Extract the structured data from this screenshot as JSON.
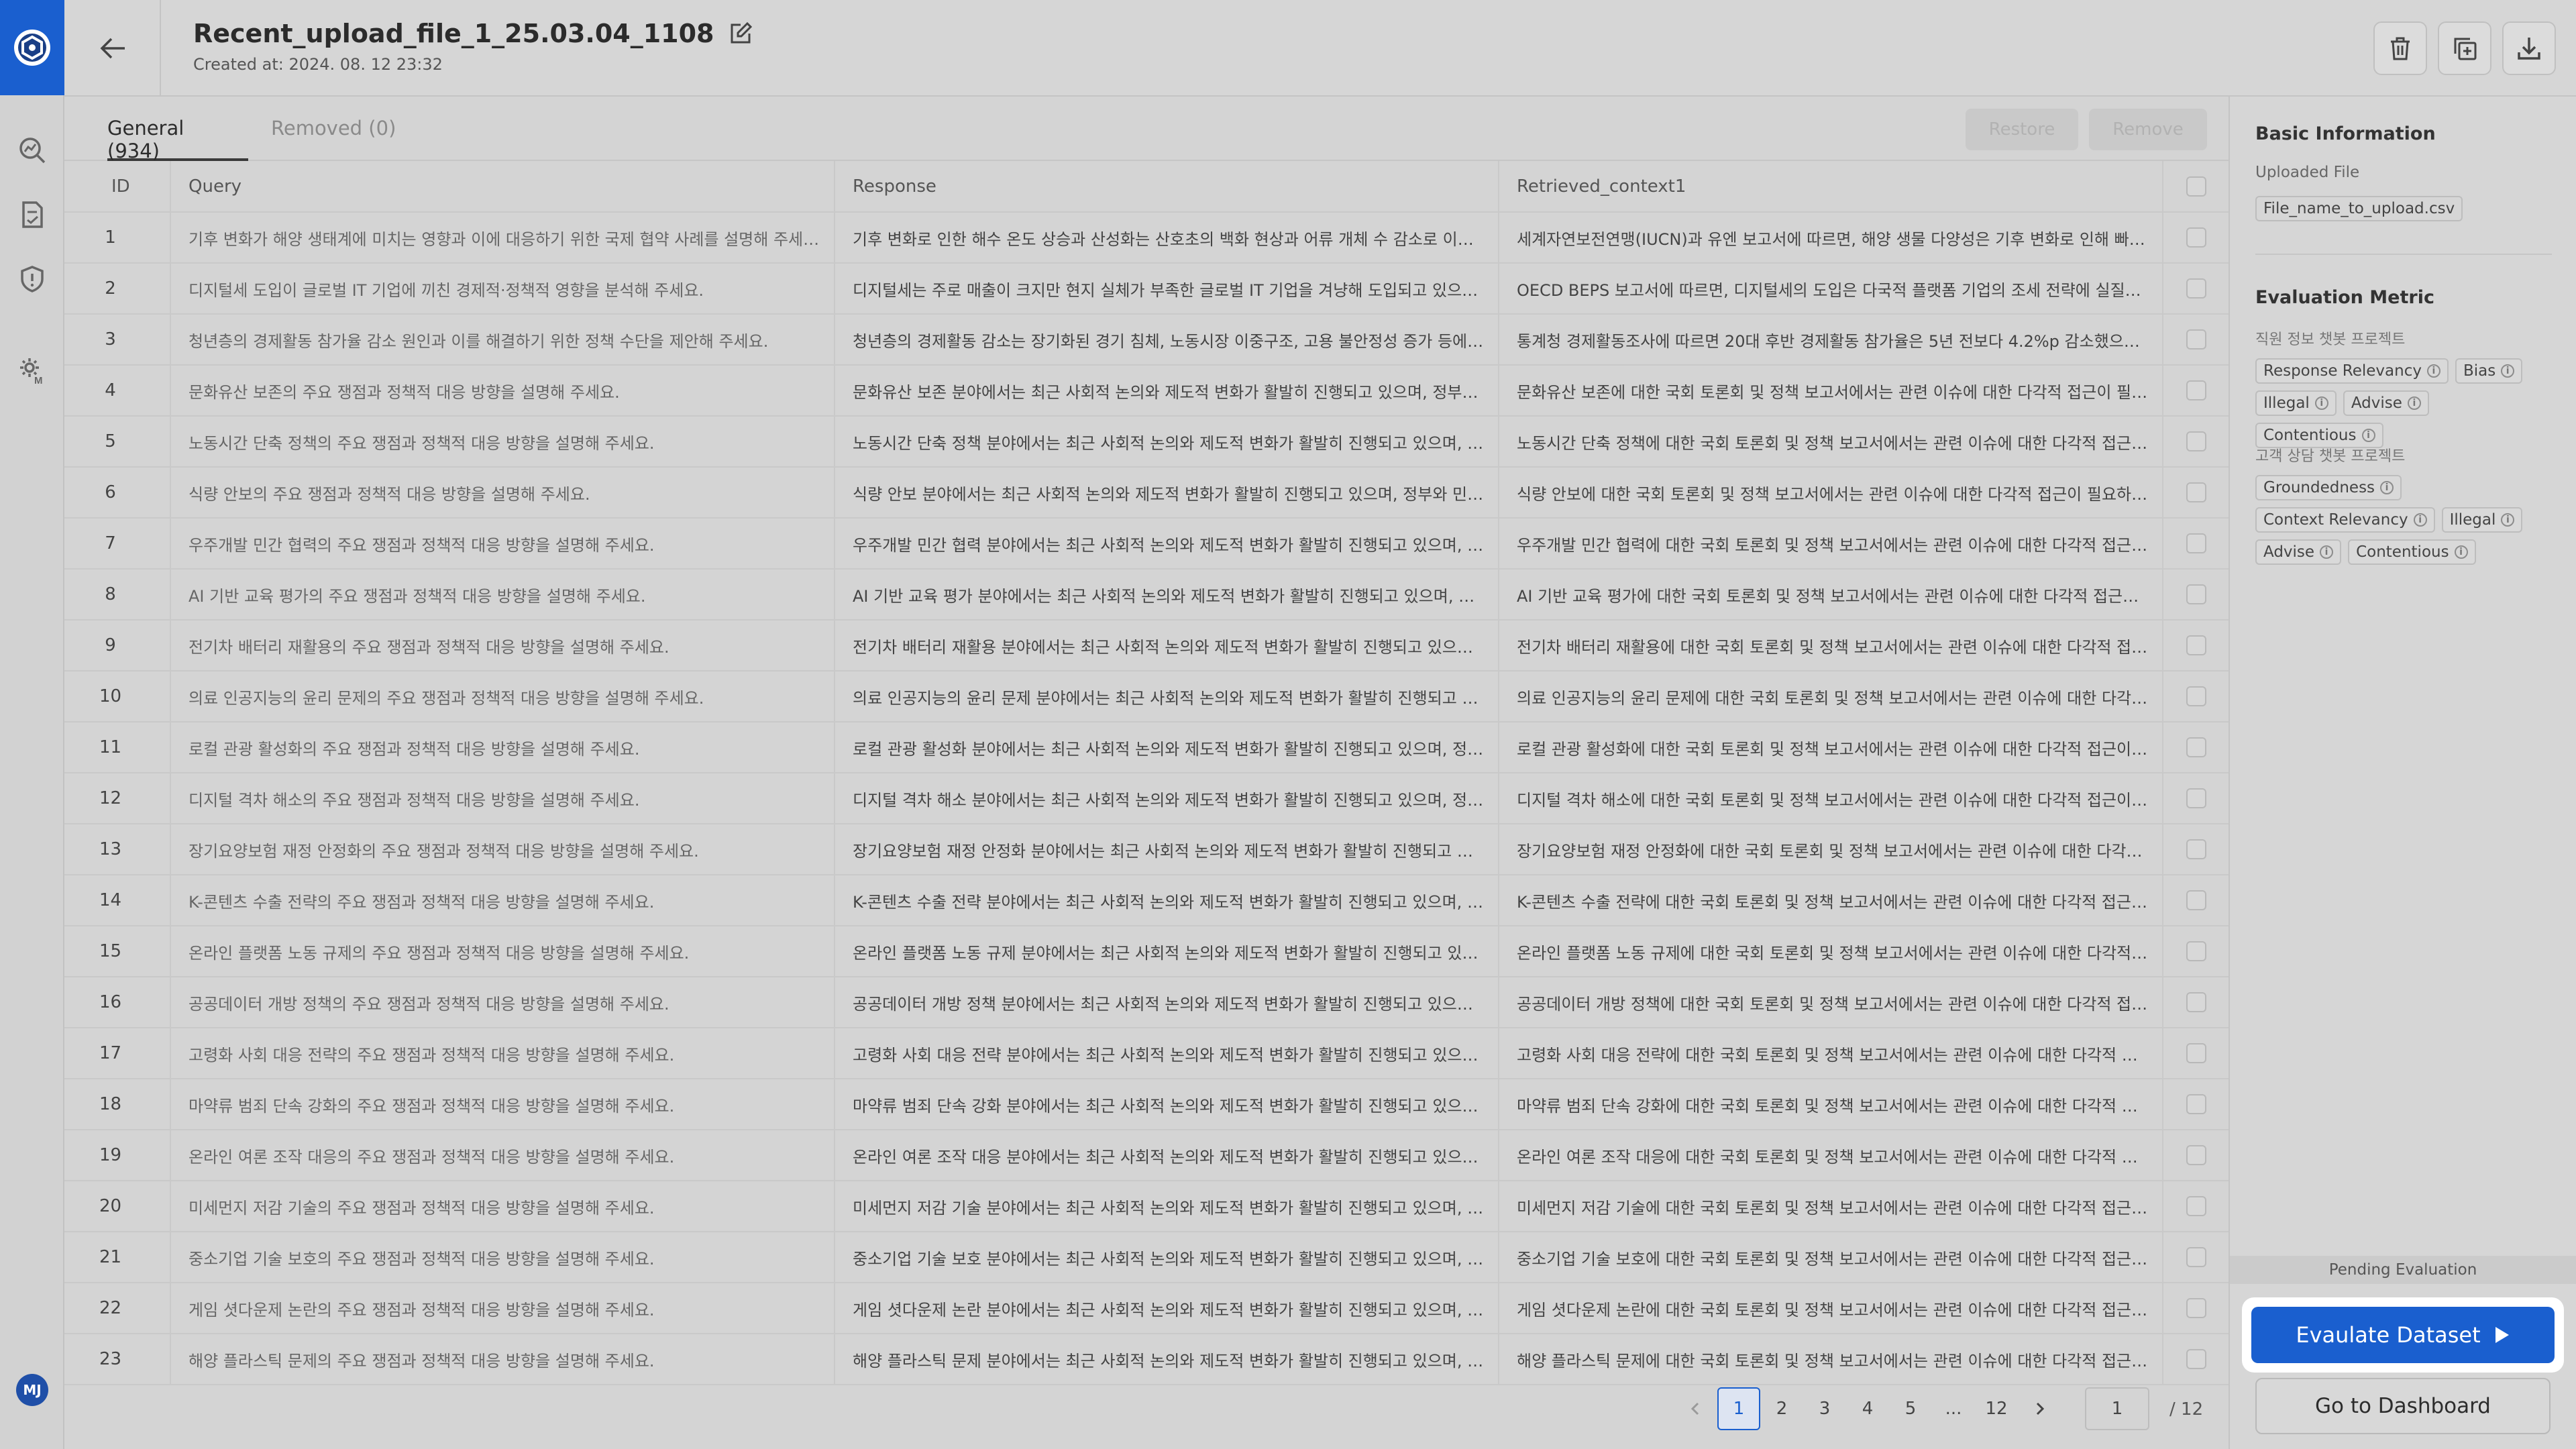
{
  "user": {
    "initials": "MJ"
  },
  "header": {
    "title": "Recent_upload_file_1_25.03.04_1108",
    "created_at": "Created at: 2024. 08. 12 23:32"
  },
  "tabs": [
    {
      "label": "General (934)"
    },
    {
      "label": "Removed (0)"
    }
  ],
  "actions": {
    "restore": "Restore",
    "remove": "Remove"
  },
  "table": {
    "columns": [
      "ID",
      "Query",
      "Response",
      "Retrieved_context1"
    ],
    "rows": [
      {
        "id": "1",
        "query": "기후 변화가 해양 생태계에 미치는 영향과 이에 대응하기 위한 국제 협약 사례를 설명해 주세요.",
        "response": "기후 변화로 인한 해수 온도 상승과 산성화는 산호초의 백화 현상과 어류 개체 수 감소로 이어지…",
        "context": "세계자연보전연맹(IUCN)과 유엔 보고서에 따르면, 해양 생물 다양성은 기후 변화로 인해 빠르…"
      },
      {
        "id": "2",
        "query": "디지털세 도입이 글로벌 IT 기업에 끼친 경제적·정책적 영향을 분석해 주세요.",
        "response": "디지털세는 주로 매출이 크지만 현지 실체가 부족한 글로벌 IT 기업을 겨냥해 도입되고 있으며,…",
        "context": "OECD BEPS 보고서에 따르면, 디지털세의 도입은 다국적 플랫폼 기업의 조세 전략에 실질적 영…"
      },
      {
        "id": "3",
        "query": "청년층의 경제활동 참가율 감소 원인과 이를 해결하기 위한 정책 수단을 제안해 주세요.",
        "response": "청년층의 경제활동 감소는 장기화된 경기 침체, 노동시장 이중구조, 고용 불안정성 증가 등에 기…",
        "context": "통계청 경제활동조사에 따르면 20대 후반 경제활동 참가율은 5년 전보다 4.2%p 감소했으며,…"
      },
      {
        "id": "4",
        "query": "문화유산 보존의 주요 쟁점과 정책적 대응 방향을 설명해 주세요.",
        "response": "문화유산 보존 분야에서는 최근 사회적 논의와 제도적 변화가 활발히 진행되고 있으며, 정부와…",
        "context": "문화유산 보존에 대한 국회 토론회 및 정책 보고서에서는 관련 이슈에 대한 다각적 접근이 필요…"
      },
      {
        "id": "5",
        "query": "노동시간 단축 정책의 주요 쟁점과 정책적 대응 방향을 설명해 주세요.",
        "response": "노동시간 단축 정책 분야에서는 최근 사회적 논의와 제도적 변화가 활발히 진행되고 있으며, 정…",
        "context": "노동시간 단축 정책에 대한 국회 토론회 및 정책 보고서에서는 관련 이슈에 대한 다각적 접근이…"
      },
      {
        "id": "6",
        "query": "식량 안보의 주요 쟁점과 정책적 대응 방향을 설명해 주세요.",
        "response": "식량 안보 분야에서는 최근 사회적 논의와 제도적 변화가 활발히 진행되고 있으며, 정부와 민간…",
        "context": "식량 안보에 대한 국회 토론회 및 정책 보고서에서는 관련 이슈에 대한 다각적 접근이 필요하다…"
      },
      {
        "id": "7",
        "query": "우주개발 민간 협력의 주요 쟁점과 정책적 대응 방향을 설명해 주세요.",
        "response": "우주개발 민간 협력 분야에서는 최근 사회적 논의와 제도적 변화가 활발히 진행되고 있으며, 정…",
        "context": "우주개발 민간 협력에 대한 국회 토론회 및 정책 보고서에서는 관련 이슈에 대한 다각적 접근이…"
      },
      {
        "id": "8",
        "query": "AI 기반 교육 평가의 주요 쟁점과 정책적 대응 방향을 설명해 주세요.",
        "response": "AI 기반 교육 평가 분야에서는 최근 사회적 논의와 제도적 변화가 활발히 진행되고 있으며, 정부…",
        "context": "AI 기반 교육 평가에 대한 국회 토론회 및 정책 보고서에서는 관련 이슈에 대한 다각적 접근이 필…"
      },
      {
        "id": "9",
        "query": "전기차 배터리 재활용의 주요 쟁점과 정책적 대응 방향을 설명해 주세요.",
        "response": "전기차 배터리 재활용 분야에서는 최근 사회적 논의와 제도적 변화가 활발히 진행되고 있으며,…",
        "context": "전기차 배터리 재활용에 대한 국회 토론회 및 정책 보고서에서는 관련 이슈에 대한 다각적 접근…"
      },
      {
        "id": "10",
        "query": "의료 인공지능의 윤리 문제의 주요 쟁점과 정책적 대응 방향을 설명해 주세요.",
        "response": "의료 인공지능의 윤리 문제 분야에서는 최근 사회적 논의와 제도적 변화가 활발히 진행되고 있…",
        "context": "의료 인공지능의 윤리 문제에 대한 국회 토론회 및 정책 보고서에서는 관련 이슈에 대한 다각적…"
      },
      {
        "id": "11",
        "query": "로컬 관광 활성화의 주요 쟁점과 정책적 대응 방향을 설명해 주세요.",
        "response": "로컬 관광 활성화 분야에서는 최근 사회적 논의와 제도적 변화가 활발히 진행되고 있으며, 정부…",
        "context": "로컬 관광 활성화에 대한 국회 토론회 및 정책 보고서에서는 관련 이슈에 대한 다각적 접근이 필…"
      },
      {
        "id": "12",
        "query": "디지털 격차 해소의 주요 쟁점과 정책적 대응 방향을 설명해 주세요.",
        "response": "디지털 격차 해소 분야에서는 최근 사회적 논의와 제도적 변화가 활발히 진행되고 있으며, 정부…",
        "context": "디지털 격차 해소에 대한 국회 토론회 및 정책 보고서에서는 관련 이슈에 대한 다각적 접근이 필…"
      },
      {
        "id": "13",
        "query": "장기요양보험 재정 안정화의 주요 쟁점과 정책적 대응 방향을 설명해 주세요.",
        "response": "장기요양보험 재정 안정화 분야에서는 최근 사회적 논의와 제도적 변화가 활발히 진행되고 있으…",
        "context": "장기요양보험 재정 안정화에 대한 국회 토론회 및 정책 보고서에서는 관련 이슈에 대한 다각적…"
      },
      {
        "id": "14",
        "query": "K-콘텐츠 수출 전략의 주요 쟁점과 정책적 대응 방향을 설명해 주세요.",
        "response": "K-콘텐츠 수출 전략 분야에서는 최근 사회적 논의와 제도적 변화가 활발히 진행되고 있으며, 정…",
        "context": "K-콘텐츠 수출 전략에 대한 국회 토론회 및 정책 보고서에서는 관련 이슈에 대한 다각적 접근이…"
      },
      {
        "id": "15",
        "query": "온라인 플랫폼 노동 규제의 주요 쟁점과 정책적 대응 방향을 설명해 주세요.",
        "response": "온라인 플랫폼 노동 규제 분야에서는 최근 사회적 논의와 제도적 변화가 활발히 진행되고 있으…",
        "context": "온라인 플랫폼 노동 규제에 대한 국회 토론회 및 정책 보고서에서는 관련 이슈에 대한 다각적 접…"
      },
      {
        "id": "16",
        "query": "공공데이터 개방 정책의 주요 쟁점과 정책적 대응 방향을 설명해 주세요.",
        "response": "공공데이터 개방 정책 분야에서는 최근 사회적 논의와 제도적 변화가 활발히 진행되고 있으며,…",
        "context": "공공데이터 개방 정책에 대한 국회 토론회 및 정책 보고서에서는 관련 이슈에 대한 다각적 접근…"
      },
      {
        "id": "17",
        "query": "고령화 사회 대응 전략의 주요 쟁점과 정책적 대응 방향을 설명해 주세요.",
        "response": "고령화 사회 대응 전략 분야에서는 최근 사회적 논의와 제도적 변화가 활발히 진행되고 있으며,…",
        "context": "고령화 사회 대응 전략에 대한 국회 토론회 및 정책 보고서에서는 관련 이슈에 대한 다각적 접근…"
      },
      {
        "id": "18",
        "query": "마약류 범죄 단속 강화의 주요 쟁점과 정책적 대응 방향을 설명해 주세요.",
        "response": "마약류 범죄 단속 강화 분야에서는 최근 사회적 논의와 제도적 변화가 활발히 진행되고 있으며,…",
        "context": "마약류 범죄 단속 강화에 대한 국회 토론회 및 정책 보고서에서는 관련 이슈에 대한 다각적 접근…"
      },
      {
        "id": "19",
        "query": "온라인 여론 조작 대응의 주요 쟁점과 정책적 대응 방향을 설명해 주세요.",
        "response": "온라인 여론 조작 대응 분야에서는 최근 사회적 논의와 제도적 변화가 활발히 진행되고 있으며,…",
        "context": "온라인 여론 조작 대응에 대한 국회 토론회 및 정책 보고서에서는 관련 이슈에 대한 다각적 접근…"
      },
      {
        "id": "20",
        "query": "미세먼지 저감 기술의 주요 쟁점과 정책적 대응 방향을 설명해 주세요.",
        "response": "미세먼지 저감 기술 분야에서는 최근 사회적 논의와 제도적 변화가 활발히 진행되고 있으며, 정…",
        "context": "미세먼지 저감 기술에 대한 국회 토론회 및 정책 보고서에서는 관련 이슈에 대한 다각적 접근이…"
      },
      {
        "id": "21",
        "query": "중소기업 기술 보호의 주요 쟁점과 정책적 대응 방향을 설명해 주세요.",
        "response": "중소기업 기술 보호 분야에서는 최근 사회적 논의와 제도적 변화가 활발히 진행되고 있으며, 정…",
        "context": "중소기업 기술 보호에 대한 국회 토론회 및 정책 보고서에서는 관련 이슈에 대한 다각적 접근이…"
      },
      {
        "id": "22",
        "query": "게임 셧다운제 논란의 주요 쟁점과 정책적 대응 방향을 설명해 주세요.",
        "response": "게임 셧다운제 논란 분야에서는 최근 사회적 논의와 제도적 변화가 활발히 진행되고 있으며, 정…",
        "context": "게임 셧다운제 논란에 대한 국회 토론회 및 정책 보고서에서는 관련 이슈에 대한 다각적 접근이…"
      },
      {
        "id": "23",
        "query": "해양 플라스틱 문제의 주요 쟁점과 정책적 대응 방향을 설명해 주세요.",
        "response": "해양 플라스틱 문제 분야에서는 최근 사회적 논의와 제도적 변화가 활발히 진행되고 있으며, 정…",
        "context": "해양 플라스틱 문제에 대한 국회 토론회 및 정책 보고서에서는 관련 이슈에 대한 다각적 접근이…"
      }
    ]
  },
  "pagination": {
    "pages": [
      "1",
      "2",
      "3",
      "4",
      "5",
      "...",
      "12"
    ],
    "current": "1",
    "total": "/ 12"
  },
  "panel": {
    "basic_title": "Basic Information",
    "uploaded_label": "Uploaded File",
    "uploaded_file": "File_name_to_upload.csv",
    "metric_title": "Evaluation Metric",
    "groups": [
      {
        "name": "직원 정보 챗봇 프로젝트",
        "metrics": [
          "Response Relevancy",
          "Bias",
          "Illegal",
          "Advise",
          "Contentious"
        ]
      },
      {
        "name": "고객 상담 챗봇 프로젝트",
        "metrics": [
          "Groundedness",
          "Context Relevancy",
          "Illegal",
          "Advise",
          "Contentious"
        ]
      }
    ],
    "pending": "Pending Evaluation",
    "evaluate": "Evaulate Dataset",
    "dashboard": "Go to Dashboard"
  }
}
